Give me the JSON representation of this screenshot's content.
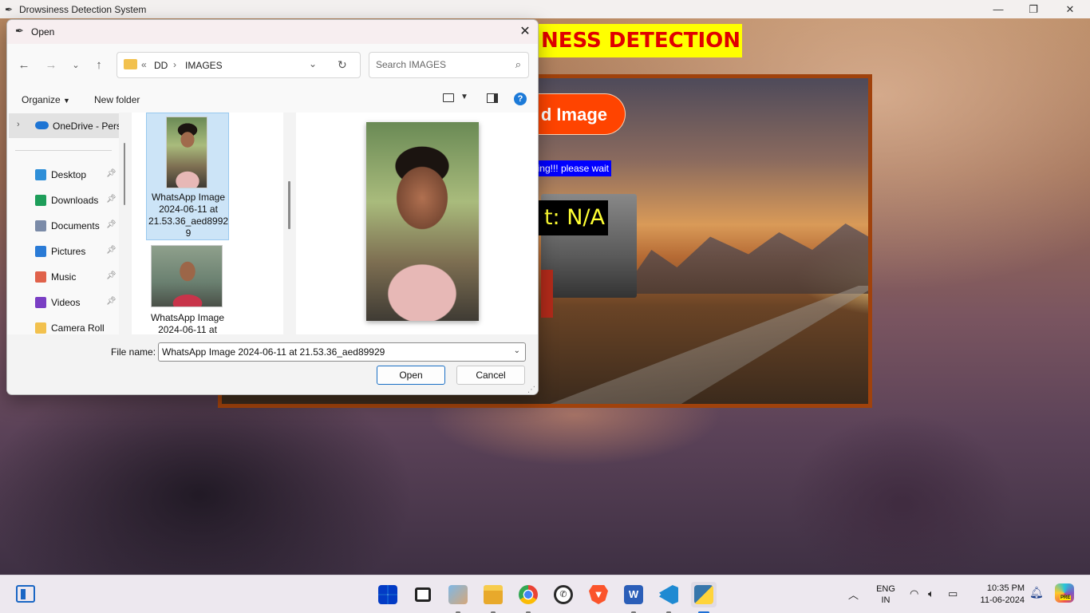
{
  "app": {
    "window_title": "Drowsiness Detection System",
    "heading": "NESS DETECTION",
    "load_button": "d Image",
    "status_label": "ing!!! please wait",
    "result_label": "t: N/A"
  },
  "dialog": {
    "title": "Open",
    "breadcrumb": {
      "overflow": "«",
      "parts": [
        "DD",
        "IMAGES"
      ]
    },
    "search_placeholder": "Search IMAGES",
    "commands": {
      "organize": "Organize",
      "new_folder": "New folder"
    },
    "sidebar": {
      "onedrive": "OneDrive - Perso",
      "items": [
        {
          "label": "Desktop",
          "icon": "desktop-icon",
          "color": "#2f8fd8"
        },
        {
          "label": "Downloads",
          "icon": "download-icon",
          "color": "#1e9e5a"
        },
        {
          "label": "Documents",
          "icon": "document-icon",
          "color": "#7b8ba8"
        },
        {
          "label": "Pictures",
          "icon": "pictures-icon",
          "color": "#2a7bd6"
        },
        {
          "label": "Music",
          "icon": "music-icon",
          "color": "#e0624b"
        },
        {
          "label": "Videos",
          "icon": "videos-icon",
          "color": "#7a3fc4"
        },
        {
          "label": "Camera Roll",
          "icon": "folder-icon",
          "color": "#f2c14e"
        }
      ]
    },
    "files": [
      {
        "name_lines": [
          "WhatsApp Image",
          "2024-06-11 at",
          "21.53.36_aed8992",
          "9"
        ],
        "selected": true
      },
      {
        "name_lines": [
          "WhatsApp Image",
          "2024-06-11 at"
        ],
        "selected": false
      }
    ],
    "file_name_label": "File name:",
    "file_name_value": "WhatsApp Image 2024-06-11 at 21.53.36_aed89929",
    "open_button": "Open",
    "cancel_button": "Cancel"
  },
  "taskbar": {
    "apps": [
      "start",
      "task-view",
      "photos",
      "file-explorer",
      "chrome",
      "whatsapp",
      "brave",
      "word",
      "vscode",
      "python"
    ],
    "language": [
      "ENG",
      "IN"
    ],
    "time": "10:35 PM",
    "date": "11-06-2024",
    "copilot_badge": "PRE"
  }
}
